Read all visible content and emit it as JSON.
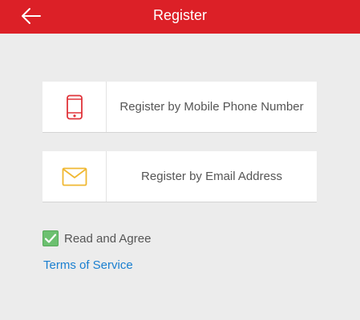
{
  "header": {
    "title": "Register",
    "back_icon": "arrow-left-icon",
    "background_color": "#dc2027"
  },
  "options": {
    "phone": {
      "label": "Register by Mobile Phone Number",
      "icon": "mobile-phone-icon",
      "icon_color": "#e0343a"
    },
    "email": {
      "label": "Register by Email Address",
      "icon": "envelope-icon",
      "icon_color": "#f0b832"
    }
  },
  "agreement": {
    "checkbox_checked": true,
    "checkbox_color": "#6cc070",
    "label": "Read and Agree",
    "terms_link": "Terms of Service",
    "link_color": "#1a7fd0"
  }
}
